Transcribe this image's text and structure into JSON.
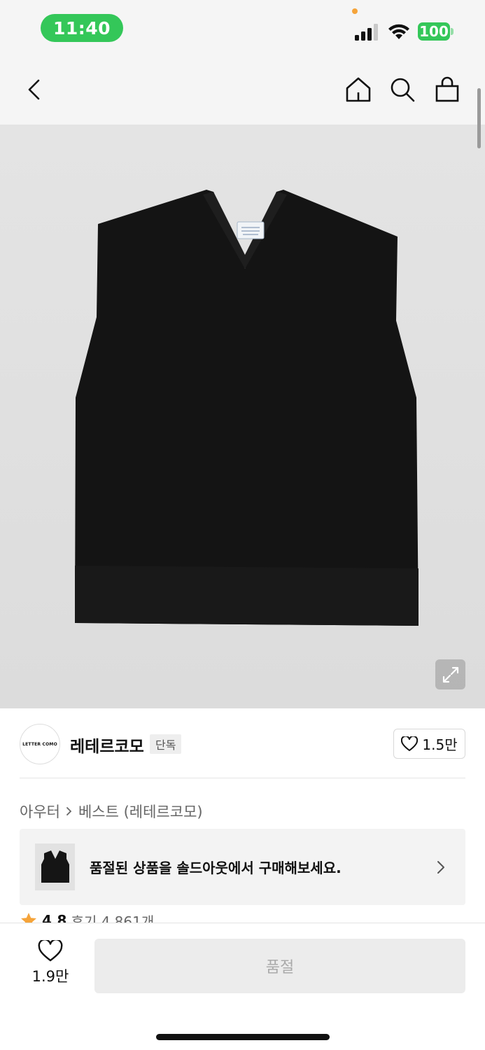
{
  "status_bar": {
    "time": "11:40",
    "battery": "100",
    "accent_color": "#34c759"
  },
  "nav": {
    "icons": [
      "chevron-left-icon",
      "home-icon",
      "search-icon",
      "shopping-bag-icon"
    ]
  },
  "product": {
    "image_icon": "expand-icon"
  },
  "brand": {
    "logo_text": "LETTER COMO",
    "name": "레테르코모",
    "badge": "단독",
    "like_count": "1.5만"
  },
  "breadcrumb": {
    "category": "아우터",
    "subcategory": "베스트 (레테르코모)"
  },
  "soldout_banner": {
    "text": "품절된 상품을 솔드아웃에서 구매해보세요."
  },
  "rating": {
    "score": "4.8",
    "reviews": "후기 4,861개",
    "star_color": "#f5a43a"
  },
  "bottom_bar": {
    "wish_count": "1.9만",
    "action_label": "품절"
  }
}
